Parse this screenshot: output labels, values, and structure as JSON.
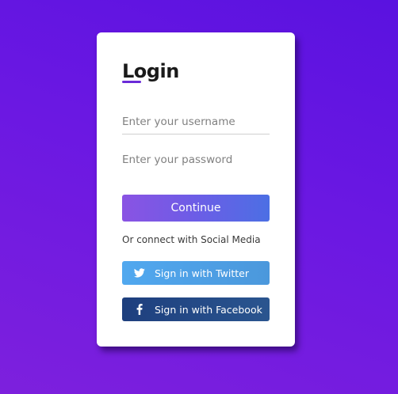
{
  "login": {
    "title": "Login",
    "username_placeholder": "Enter your username",
    "password_placeholder": "Enter your password",
    "continue_label": "Continue",
    "social_text": "Or connect with Social Media",
    "twitter_label": "Sign in with Twitter",
    "facebook_label": "Sign in with Facebook"
  },
  "icons": {
    "twitter": "twitter-icon",
    "facebook": "facebook-icon"
  },
  "colors": {
    "accent": "#6a2bd8",
    "twitter": "#51a8ef",
    "facebook": "#1e3f7e"
  }
}
